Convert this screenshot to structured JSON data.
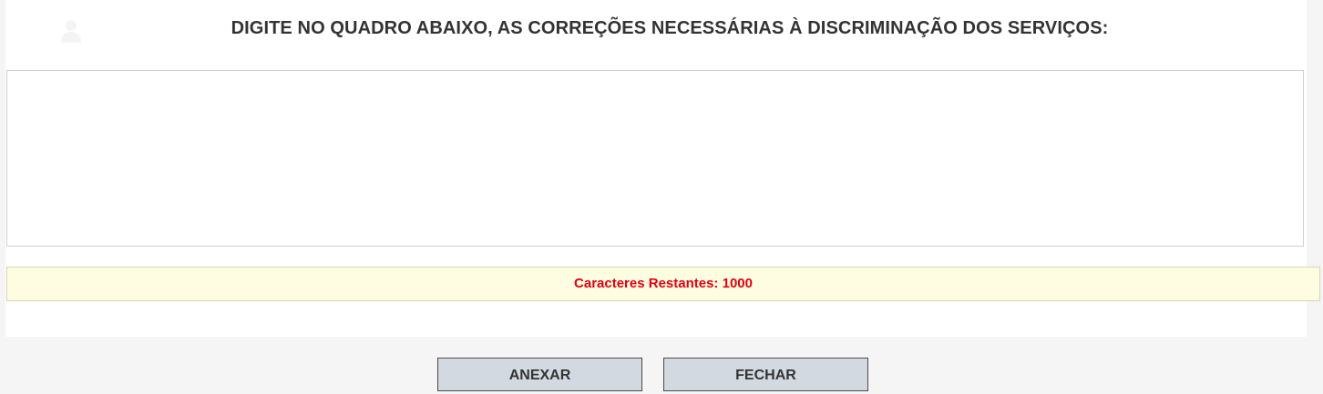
{
  "header": {
    "title": "DIGITE NO QUADRO ABAIXO, AS CORREÇÕES NECESSÁRIAS À DISCRIMINAÇÃO DOS SERVIÇOS:",
    "icon": "user-icon"
  },
  "editor": {
    "value": "",
    "placeholder": ""
  },
  "counter": {
    "text": "Caracteres Restantes: 1000"
  },
  "actions": {
    "attach_label": "ANEXAR",
    "close_label": "FECHAR"
  },
  "colors": {
    "counter_text": "#e0000f",
    "counter_background": "#fefde2",
    "button_background": "#d3d9e0"
  }
}
